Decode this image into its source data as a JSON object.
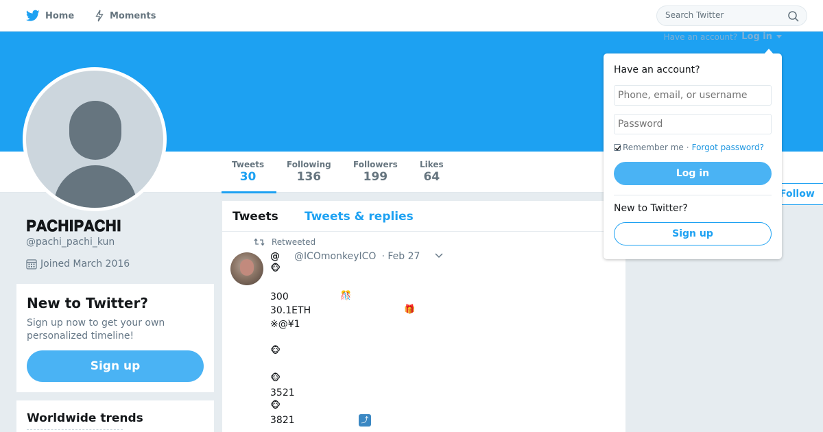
{
  "nav": {
    "home_label": "Home",
    "moments_label": "Moments",
    "search_placeholder": "Search Twitter"
  },
  "header_login": {
    "prompt": "Have an account?",
    "link": "Log in"
  },
  "profile": {
    "name": "𝐏𝐀𝐂𝐇𝐈𝐏𝐀𝐂𝐇𝐈",
    "handle": "@pachi_pachi_kun",
    "joined": "Joined March 2016"
  },
  "stats": [
    {
      "label": "Tweets",
      "value": "30"
    },
    {
      "label": "Following",
      "value": "136"
    },
    {
      "label": "Followers",
      "value": "199"
    },
    {
      "label": "Likes",
      "value": "64"
    }
  ],
  "follow_label": "Follow",
  "signup_card": {
    "title": "New to Twitter?",
    "description": "Sign up now to get your own personalized timeline!",
    "button": "Sign up"
  },
  "trends": {
    "title": "Worldwide trends"
  },
  "timeline": {
    "tabs": [
      "Tweets",
      "Tweets & replies"
    ],
    "retweet_context": "Retweeted",
    "tweet": {
      "display_name": "@",
      "handle": "@ICOmonkeyICO",
      "date": "· Feb 27",
      "lines": [
        "300",
        "30.1ETH",
        "※@¥1",
        "3521",
        "3821"
      ]
    }
  },
  "login_dropdown": {
    "heading": "Have an account?",
    "username_placeholder": "Phone, email, or username",
    "password_placeholder": "Password",
    "remember_label": "Remember me",
    "separator": "·",
    "forgot_label": "Forgot password?",
    "login_button": "Log in",
    "new_heading": "New to Twitter?",
    "signup_button": "Sign up"
  },
  "colors": {
    "brand": "#1da1f2",
    "button": "#4ab3f4",
    "background": "#e6ecf0"
  }
}
